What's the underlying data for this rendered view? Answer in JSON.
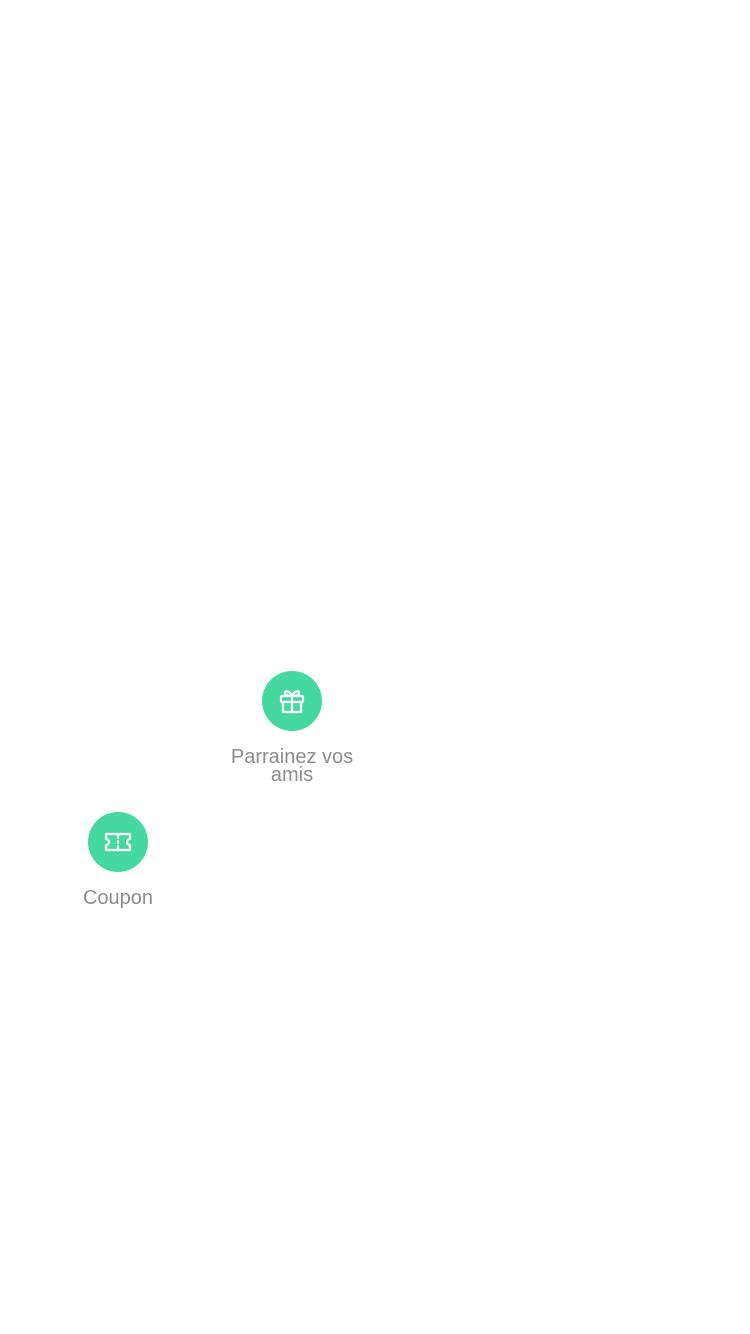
{
  "menu": {
    "items": [
      {
        "id": "refer",
        "label": "Parrainez vos amis",
        "icon": "gift-icon"
      },
      {
        "id": "coupon",
        "label": "Coupon",
        "icon": "ticket-icon"
      }
    ]
  },
  "colors": {
    "icon_background": "#45d8a1",
    "icon_foreground": "#ffffff",
    "label_text": "#8e8e8e",
    "page_background": "#ffffff"
  }
}
